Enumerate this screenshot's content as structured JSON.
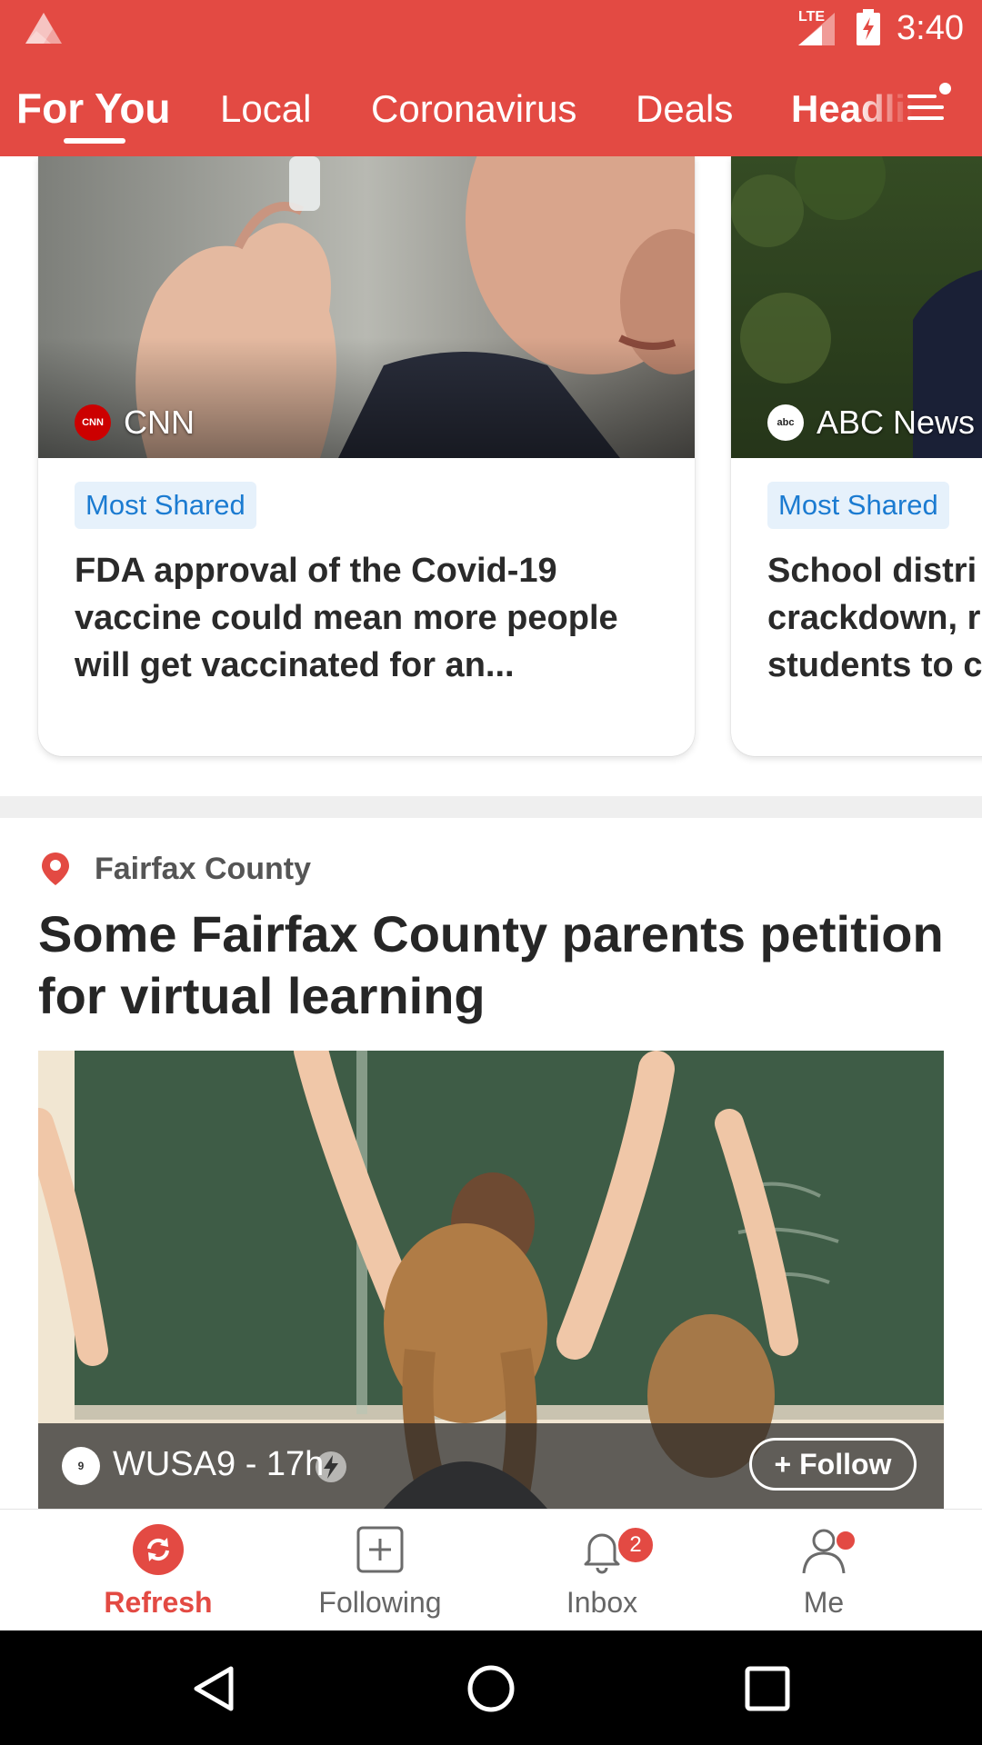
{
  "status_bar": {
    "network": "LTE",
    "time": "3:40"
  },
  "tabs": [
    {
      "label": "For You",
      "active": true
    },
    {
      "label": "Local",
      "active": false
    },
    {
      "label": "Coronavirus",
      "active": false
    },
    {
      "label": "Deals",
      "active": false
    },
    {
      "label": "Headlines",
      "active": false
    }
  ],
  "tab_menu_icon": "hamburger-menu-icon",
  "colors": {
    "brand_red": "#E34A43",
    "badge_blue": "#1B7BD1",
    "badge_bg": "#E6F1FB"
  },
  "carousel": [
    {
      "source": "CNN",
      "badge": "Most Shared",
      "title": "FDA approval of the Covid-19 vaccine could mean more people will get vaccinated for an..."
    },
    {
      "source": "ABC News",
      "badge": "Most Shared",
      "title_lines": [
        "School distri",
        "crackdown, r",
        "students to c"
      ]
    }
  ],
  "local_article": {
    "location": "Fairfax County",
    "title": "Some Fairfax County parents petition for virtual learning",
    "source_time": "WUSA9 - 17h",
    "follow_label": "+ Follow"
  },
  "bottom_nav": [
    {
      "label": "Refresh",
      "icon": "refresh-icon",
      "active": true
    },
    {
      "label": "Following",
      "icon": "add-square-icon",
      "active": false
    },
    {
      "label": "Inbox",
      "icon": "bell-icon",
      "active": false,
      "badge": "2"
    },
    {
      "label": "Me",
      "icon": "person-icon",
      "active": false,
      "dot": true
    }
  ]
}
